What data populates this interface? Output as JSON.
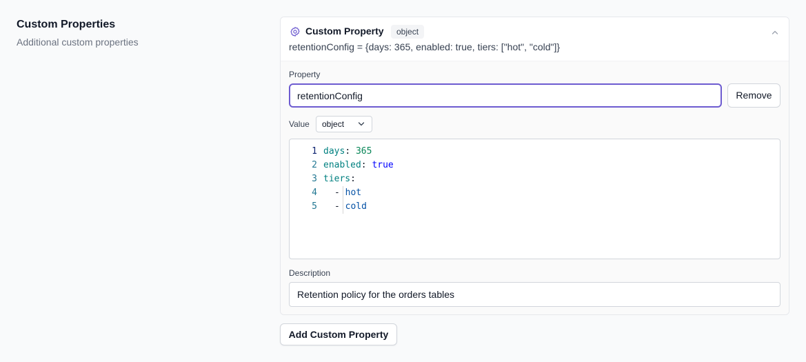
{
  "section": {
    "title": "Custom Properties",
    "subtitle": "Additional custom properties"
  },
  "card": {
    "title": "Custom Property",
    "type_badge": "object",
    "summary": "retentionConfig = {days: 365, enabled: true, tiers: [\"hot\", \"cold\"]}",
    "property_label": "Property",
    "property_value": "retentionConfig",
    "remove_label": "Remove",
    "value_label": "Value",
    "value_type": "object",
    "code_lines": [
      {
        "num": "1",
        "key": "days",
        "sep": ": ",
        "value": "365"
      },
      {
        "num": "2",
        "key": "enabled",
        "sep": ": ",
        "value": "true"
      },
      {
        "num": "3",
        "key": "tiers",
        "sep": ":",
        "value": ""
      },
      {
        "num": "4",
        "dash": "- ",
        "value": "hot"
      },
      {
        "num": "5",
        "dash": "- ",
        "value": "cold"
      }
    ],
    "description_label": "Description",
    "description_value": "Retention policy for the orders tables"
  },
  "add_button_label": "Add Custom Property",
  "colors": {
    "accent": "#6d5bd0",
    "code_key": "#008080",
    "code_number": "#098658",
    "code_bool": "#0000ff",
    "code_string": "#0451a5",
    "line_number": "#237893"
  }
}
